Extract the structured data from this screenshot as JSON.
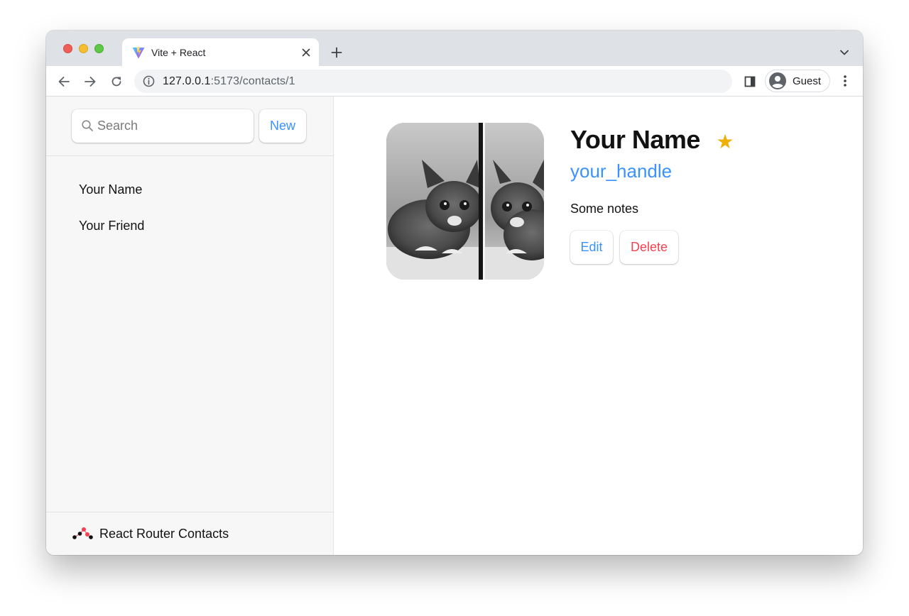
{
  "browser": {
    "tab_title": "Vite + React",
    "url_host": "127.0.0.1",
    "url_path": ":5173/contacts/1",
    "profile_label": "Guest"
  },
  "sidebar": {
    "search_placeholder": "Search",
    "new_button_label": "New",
    "contacts": [
      {
        "label": "Your Name"
      },
      {
        "label": "Your Friend"
      }
    ],
    "footer_title": "React Router Contacts"
  },
  "contact": {
    "name": "Your Name",
    "favorite_glyph": "★",
    "handle": "your_handle",
    "notes": "Some notes",
    "edit_label": "Edit",
    "delete_label": "Delete"
  },
  "colors": {
    "accent": "#3992ff",
    "danger": "#f44250",
    "favorite": "#eeb004",
    "sidebar_bg": "#f7f7f7"
  },
  "icons": {
    "tab": [
      "vite-logo-icon",
      "close-icon",
      "plus-icon",
      "chevron-down-icon"
    ],
    "toolbar": [
      "back-arrow-icon",
      "forward-arrow-icon",
      "reload-icon",
      "info-icon",
      "side-panel-icon",
      "account-circle-icon",
      "more-vert-icon"
    ],
    "page": [
      "search-icon",
      "star-icon",
      "react-router-logo-icon"
    ]
  }
}
